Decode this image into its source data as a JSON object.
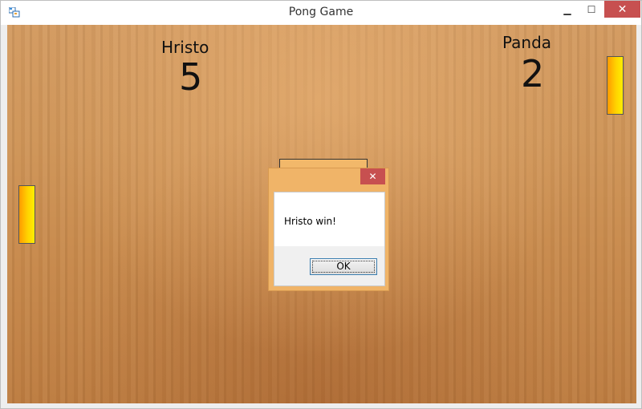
{
  "window": {
    "title": "Pong Game",
    "minimize_glyph": "▁",
    "maximize_glyph": "☐",
    "close_glyph": "✕"
  },
  "players": {
    "left": {
      "name": "Hristo",
      "score": "5"
    },
    "right": {
      "name": "Panda",
      "score": "2"
    }
  },
  "dialog": {
    "message": "Hristo win!",
    "ok_label": "OK",
    "close_glyph": "✕"
  },
  "colors": {
    "paddle_gradient": [
      "#ff9a00",
      "#ffee00"
    ],
    "close_red": "#c75050",
    "dialog_frame": "#f0b468"
  },
  "icons": {
    "app": "app-icon"
  }
}
